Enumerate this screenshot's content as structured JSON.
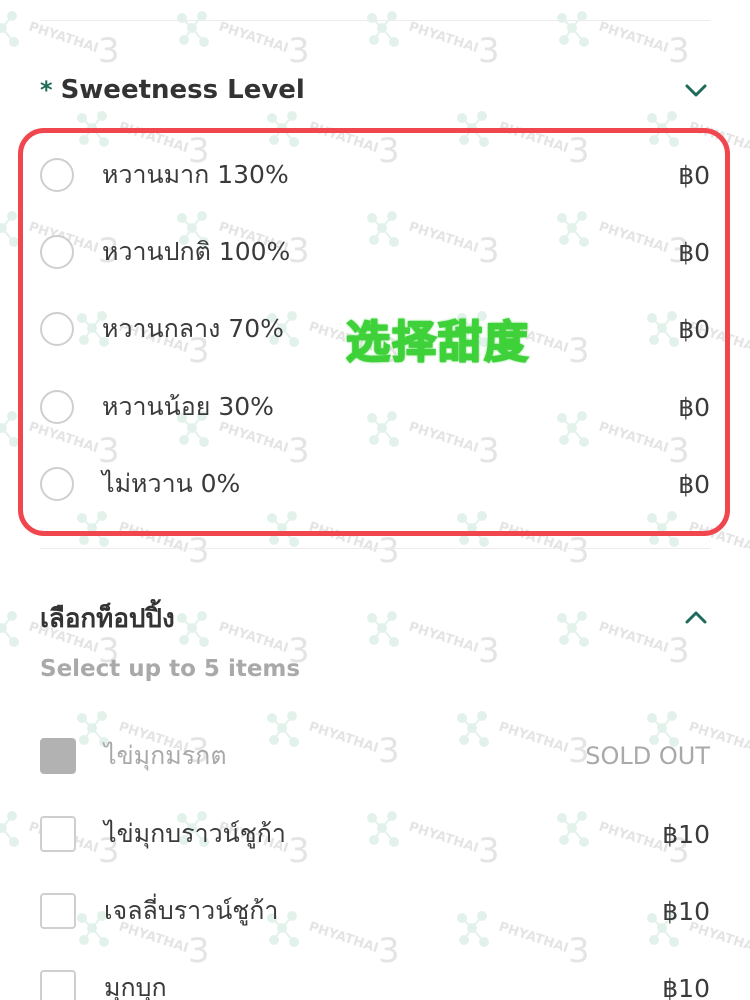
{
  "sweetness": {
    "required_mark": "*",
    "title": "Sweetness Level",
    "options": [
      {
        "label": "หวานมาก 130%",
        "price": "฿0"
      },
      {
        "label": "หวานปกติ 100%",
        "price": "฿0"
      },
      {
        "label": "หวานกลาง 70%",
        "price": "฿0"
      },
      {
        "label": "หวานน้อย 30%",
        "price": "฿0"
      },
      {
        "label": "ไม่หวาน 0%",
        "price": "฿0"
      }
    ]
  },
  "overlay_note": "选择甜度",
  "toppings": {
    "title": "เลือกท็อปปิ้ง",
    "subtitle": "Select up to 5 items",
    "items": [
      {
        "label": "ไข่มุกมรกต",
        "price": "SOLD OUT",
        "sold_out": true
      },
      {
        "label": "ไข่มุกบราวน์ชูก้า",
        "price": "฿10",
        "sold_out": false
      },
      {
        "label": "เจลลี่บราวน์ชูก้า",
        "price": "฿10",
        "sold_out": false
      },
      {
        "label": "มุกบุก",
        "price": "฿10",
        "sold_out": false
      }
    ]
  },
  "watermark": {
    "brand": "PHYATHAI",
    "number": "3"
  },
  "colors": {
    "accent": "#1e6b5b",
    "highlight": "#f0464e",
    "overlay_glow": "#3fd13a",
    "muted": "#a9a9a9"
  }
}
